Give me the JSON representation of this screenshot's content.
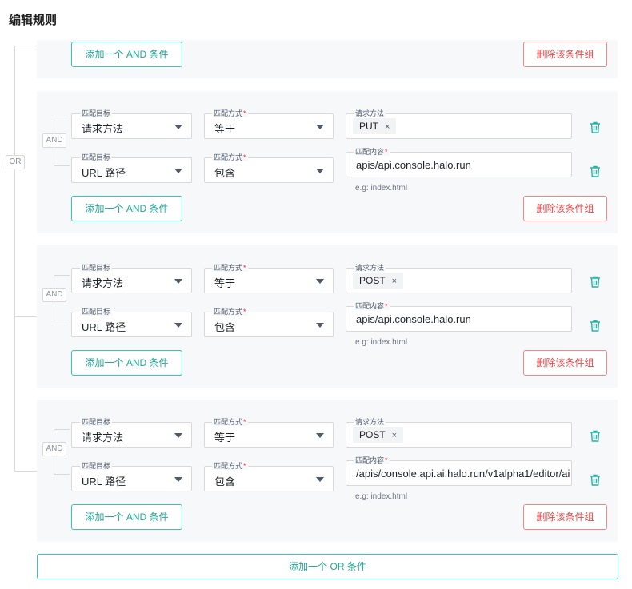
{
  "page": {
    "title": "编辑规则"
  },
  "labels": {
    "or": "OR",
    "and": "AND",
    "match_target": "匹配目标",
    "match_mode": "匹配方式",
    "request_method": "请求方法",
    "match_content": "匹配内容",
    "required_mark": "*",
    "hint": "e.g: index.html",
    "add_and": "添加一个 AND 条件",
    "delete_group": "删除该条件组",
    "add_or": "添加一个 OR 条件",
    "tag_close": "×"
  },
  "groups": [
    {
      "rows": [
        {
          "target": "请求方法",
          "mode": "等于",
          "tag": "PUT"
        },
        {
          "target": "URL 路径",
          "mode": "包含",
          "value": "apis/api.console.halo.run"
        }
      ]
    },
    {
      "rows": [
        {
          "target": "请求方法",
          "mode": "等于",
          "tag": "POST"
        },
        {
          "target": "URL 路径",
          "mode": "包含",
          "value": "apis/api.console.halo.run"
        }
      ]
    },
    {
      "rows": [
        {
          "target": "请求方法",
          "mode": "等于",
          "tag": "POST"
        },
        {
          "target": "URL 路径",
          "mode": "包含",
          "value": "/apis/console.api.ai.halo.run/v1alpha1/editor/ai"
        }
      ]
    }
  ],
  "colors": {
    "accent": "#36c5b4",
    "danger": "#f08787",
    "panel": "#f7f8fa"
  },
  "icons": {
    "delete": "trash-icon",
    "dropdown": "caret-down-icon"
  }
}
